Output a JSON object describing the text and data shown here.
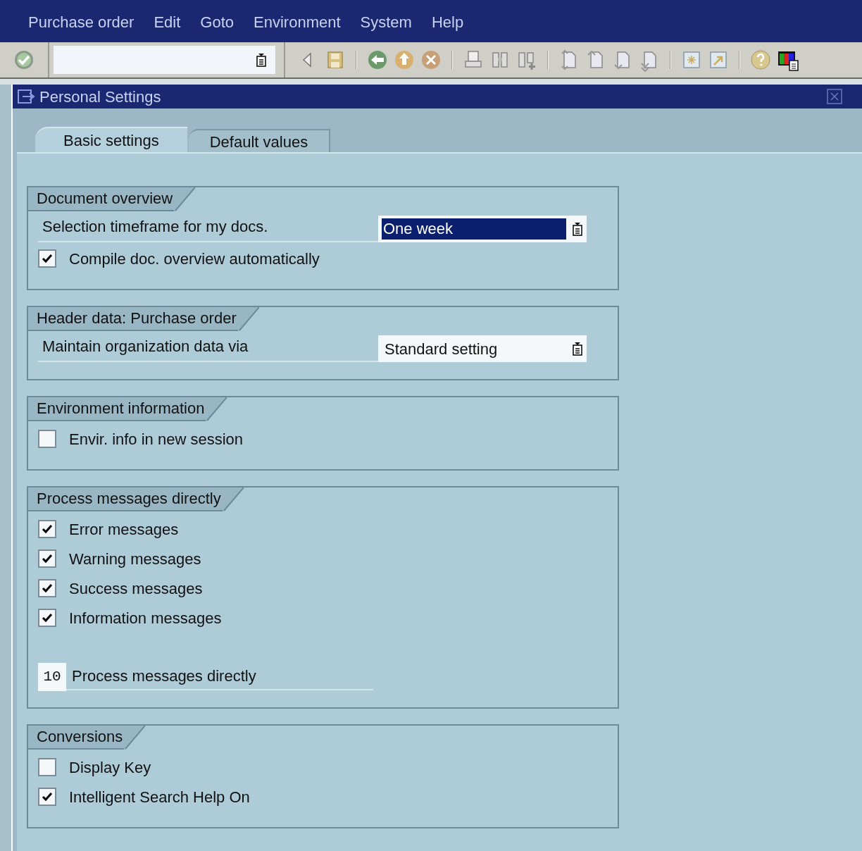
{
  "menu": [
    {
      "label": "Purchase order"
    },
    {
      "label": "Edit"
    },
    {
      "label": "Goto"
    },
    {
      "label": "Environment"
    },
    {
      "label": "System"
    },
    {
      "label": "Help"
    }
  ],
  "dialog": {
    "title": "Personal Settings"
  },
  "tabs": [
    {
      "label": "Basic settings",
      "selected": true
    },
    {
      "label": "Default values",
      "selected": false
    }
  ],
  "groups": [
    {
      "title": "Document overview",
      "rows": [
        {
          "kind": "dropdown",
          "label": "Selection timeframe for my docs.",
          "value": "One week",
          "selected": true
        },
        {
          "kind": "checkbox",
          "label": "Compile doc. overview automatically",
          "checked": true
        }
      ]
    },
    {
      "title": "Header data: Purchase order",
      "rows": [
        {
          "kind": "dropdown",
          "label": "Maintain organization data via",
          "value": "Standard setting",
          "selected": false
        }
      ]
    },
    {
      "title": "Environment information",
      "rows": [
        {
          "kind": "checkbox",
          "label": "Envir. info in new session",
          "checked": false
        }
      ]
    },
    {
      "title": "Process messages directly",
      "rows": [
        {
          "kind": "checkbox",
          "label": "Error messages",
          "checked": true
        },
        {
          "kind": "checkbox",
          "label": "Warning messages",
          "checked": true
        },
        {
          "kind": "checkbox",
          "label": "Success messages",
          "checked": true
        },
        {
          "kind": "checkbox",
          "label": "Information messages",
          "checked": true
        },
        {
          "kind": "number",
          "value": "10",
          "label": "Process messages directly"
        }
      ]
    },
    {
      "title": "Conversions",
      "rows": [
        {
          "kind": "checkbox",
          "label": "Display Key",
          "checked": false
        },
        {
          "kind": "checkbox",
          "label": "Intelligent Search Help On",
          "checked": true
        }
      ]
    }
  ]
}
